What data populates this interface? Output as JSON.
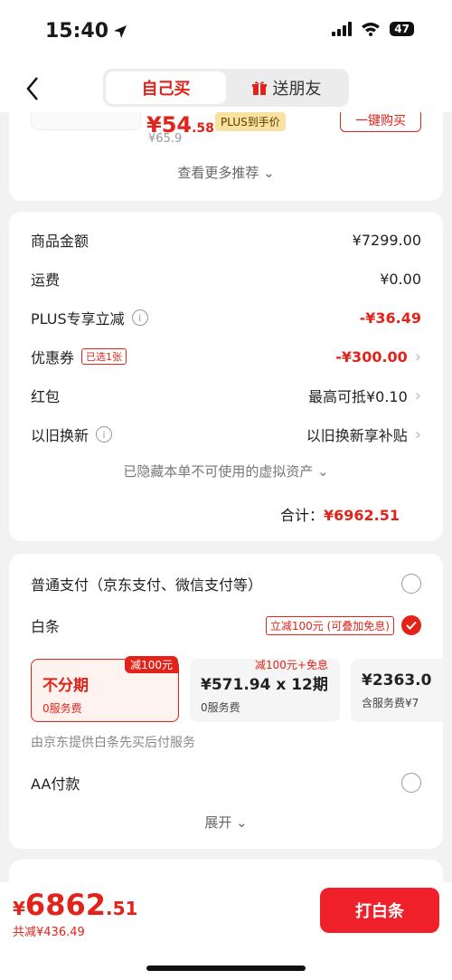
{
  "status_bar": {
    "time": "15:40",
    "battery": "47"
  },
  "nav": {
    "tab_self": "自己买",
    "tab_gift": "送朋友"
  },
  "recommend": {
    "price_int": "¥54",
    "price_dec": ".58",
    "plus_badge": "PLUS到手价",
    "orig_price": "¥65.9",
    "buy_button": "一键购买",
    "more": "查看更多推荐"
  },
  "summary": {
    "rows": [
      {
        "label": "商品金额",
        "value": "¥7299.00"
      },
      {
        "label": "运费",
        "value": "¥0.00"
      },
      {
        "label": "PLUS专享立减",
        "value": "-¥36.49"
      },
      {
        "label": "优惠券",
        "tag": "已选1张",
        "value": "-¥300.00"
      },
      {
        "label": "红包",
        "value": "最高可抵¥0.10"
      },
      {
        "label": "以旧换新",
        "value": "以旧换新享补贴"
      }
    ],
    "hidden_note": "已隐藏本单不可使用的虚拟资产",
    "total_label": "合计：",
    "total_value": "¥6962.51"
  },
  "payment": {
    "normal_pay": "普通支付（京东支付、微信支付等）",
    "baitiao": "白条",
    "baitiao_promo": "立减100元 (可叠加免息)",
    "plans": [
      {
        "title": "不分期",
        "sub": "0服务费",
        "badge": "减100元"
      },
      {
        "title": "¥571.94 x 12期",
        "sub": "0服务费",
        "note": "减100元+免息"
      },
      {
        "title": "¥2363.0",
        "sub": "含服务费¥7"
      }
    ],
    "provider": "由京东提供白条先买后付服务",
    "aa_pay": "AA付款",
    "expand": "展开"
  },
  "bottom": {
    "currency": "¥",
    "price_int": "6862",
    "price_dec": ".51",
    "saved": "共减¥436.49",
    "pay_button": "打白条"
  }
}
